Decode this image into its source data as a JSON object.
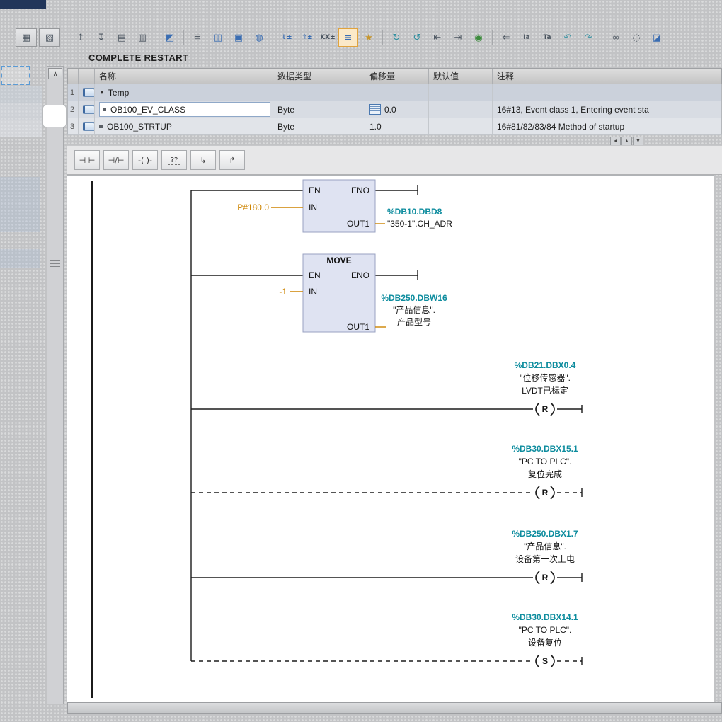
{
  "block_title": "COMPLETE RESTART",
  "colors": {
    "operand": "#0d8c9e",
    "constant": "#cd8400",
    "block_fill": "#dfe3f2",
    "accent_select": "#5b9bd5"
  },
  "toolbar": {
    "left": [
      {
        "name": "table-view-icon",
        "glyph": "▦"
      },
      {
        "name": "form-view-icon",
        "glyph": "▨"
      }
    ],
    "main": [
      {
        "name": "insert-row-icon",
        "glyph": "↥"
      },
      {
        "name": "append-row-icon",
        "glyph": "↧"
      },
      {
        "name": "open-parameters-icon",
        "glyph": "▤"
      },
      {
        "name": "reset-values-icon",
        "glyph": "▥"
      },
      {
        "name": "keep-actual-values-icon",
        "glyph": "◩"
      },
      {
        "name": "expand-rows-icon",
        "glyph": "≣"
      },
      {
        "name": "split-editor-icon",
        "glyph": "◫"
      },
      {
        "name": "window-layout-icon",
        "glyph": "▣"
      },
      {
        "name": "comments-icon",
        "glyph": "◍"
      },
      {
        "name": "expand-networks-icon",
        "glyph": "⇓±"
      },
      {
        "name": "collapse-networks-icon",
        "glyph": "⇑±"
      },
      {
        "name": "symbolic-access-icon",
        "glyph": "KX±"
      },
      {
        "name": "network-comments-icon",
        "glyph": "≡"
      },
      {
        "name": "favorites-icon",
        "glyph": "★"
      },
      {
        "name": "go-online-icon",
        "glyph": "↻"
      },
      {
        "name": "go-offline-icon",
        "glyph": "↺"
      },
      {
        "name": "jump-previous-icon",
        "glyph": "⇤"
      },
      {
        "name": "jump-next-icon",
        "glyph": "⇥"
      },
      {
        "name": "monitoring-icon",
        "glyph": "◉"
      },
      {
        "name": "modify-operand-icon",
        "glyph": "⇐"
      },
      {
        "name": "monitor-input-icon",
        "glyph": "Ia"
      },
      {
        "name": "monitor-time-icon",
        "glyph": "Ta"
      },
      {
        "name": "load-snapshot-icon",
        "glyph": "↶"
      },
      {
        "name": "apply-snapshot-icon",
        "glyph": "↷"
      },
      {
        "name": "cross-reference-icon",
        "glyph": "∞"
      },
      {
        "name": "consistency-check-icon",
        "glyph": "◌"
      },
      {
        "name": "data-block-icon",
        "glyph": "◪"
      }
    ]
  },
  "table": {
    "columns": [
      "名称",
      "数据类型",
      "偏移量",
      "默认值",
      "注释"
    ],
    "rows": [
      {
        "num": "1",
        "expander": "▼",
        "name": "Temp",
        "type": "",
        "offset": "",
        "default": "",
        "comment": ""
      },
      {
        "num": "2",
        "name": "OB100_EV_CLASS",
        "type": "Byte",
        "offset": "0.0",
        "default": "",
        "comment": "16#13, Event class 1, Entering event sta"
      },
      {
        "num": "3",
        "name": "OB100_STRTUP",
        "type": "Byte",
        "offset": "1.0",
        "default": "",
        "comment": "16#81/82/83/84 Method of startup"
      }
    ]
  },
  "table_scroll": {
    "left": "◄",
    "up": "▲",
    "down": "▼"
  },
  "sidebar": {
    "collapse": "∧"
  },
  "lad_toolbar": [
    {
      "name": "contact-no-icon",
      "glyph": "⊣ ⊢"
    },
    {
      "name": "contact-nc-icon",
      "glyph": "⊣/⊢"
    },
    {
      "name": "coil-icon",
      "glyph": "-( )-"
    },
    {
      "name": "empty-box-icon",
      "glyph": "??"
    },
    {
      "name": "open-branch-icon",
      "glyph": "↳"
    },
    {
      "name": "close-branch-icon",
      "glyph": "↱"
    }
  ],
  "network": {
    "block1": {
      "en": "EN",
      "eno": "ENO",
      "in": "IN",
      "out": "OUT1",
      "in_value": "P#180.0",
      "out_addr": "%DB10.DBD8",
      "out_name": "\"350-1\".CH_ADR"
    },
    "move": {
      "title": "MOVE",
      "en": "EN",
      "eno": "ENO",
      "in": "IN",
      "out": "OUT1",
      "in_value": "-1",
      "out_addr": "%DB250.DBW16",
      "out_l1": "\"产品信息\".",
      "out_l2": "产品型号"
    },
    "coils": [
      {
        "addr": "%DB21.DBX0.4",
        "l1": "\"位移传感器\".",
        "l2": "LVDT已标定",
        "letter": "R"
      },
      {
        "addr": "%DB30.DBX15.1",
        "l1": "\"PC TO PLC\".",
        "l2": "复位完成",
        "letter": "R"
      },
      {
        "addr": "%DB250.DBX1.7",
        "l1": "\"产品信息\".",
        "l2": "设备第一次上电",
        "letter": "R"
      },
      {
        "addr": "%DB30.DBX14.1",
        "l1": "\"PC TO PLC\".",
        "l2": "设备复位",
        "letter": "S"
      }
    ]
  }
}
